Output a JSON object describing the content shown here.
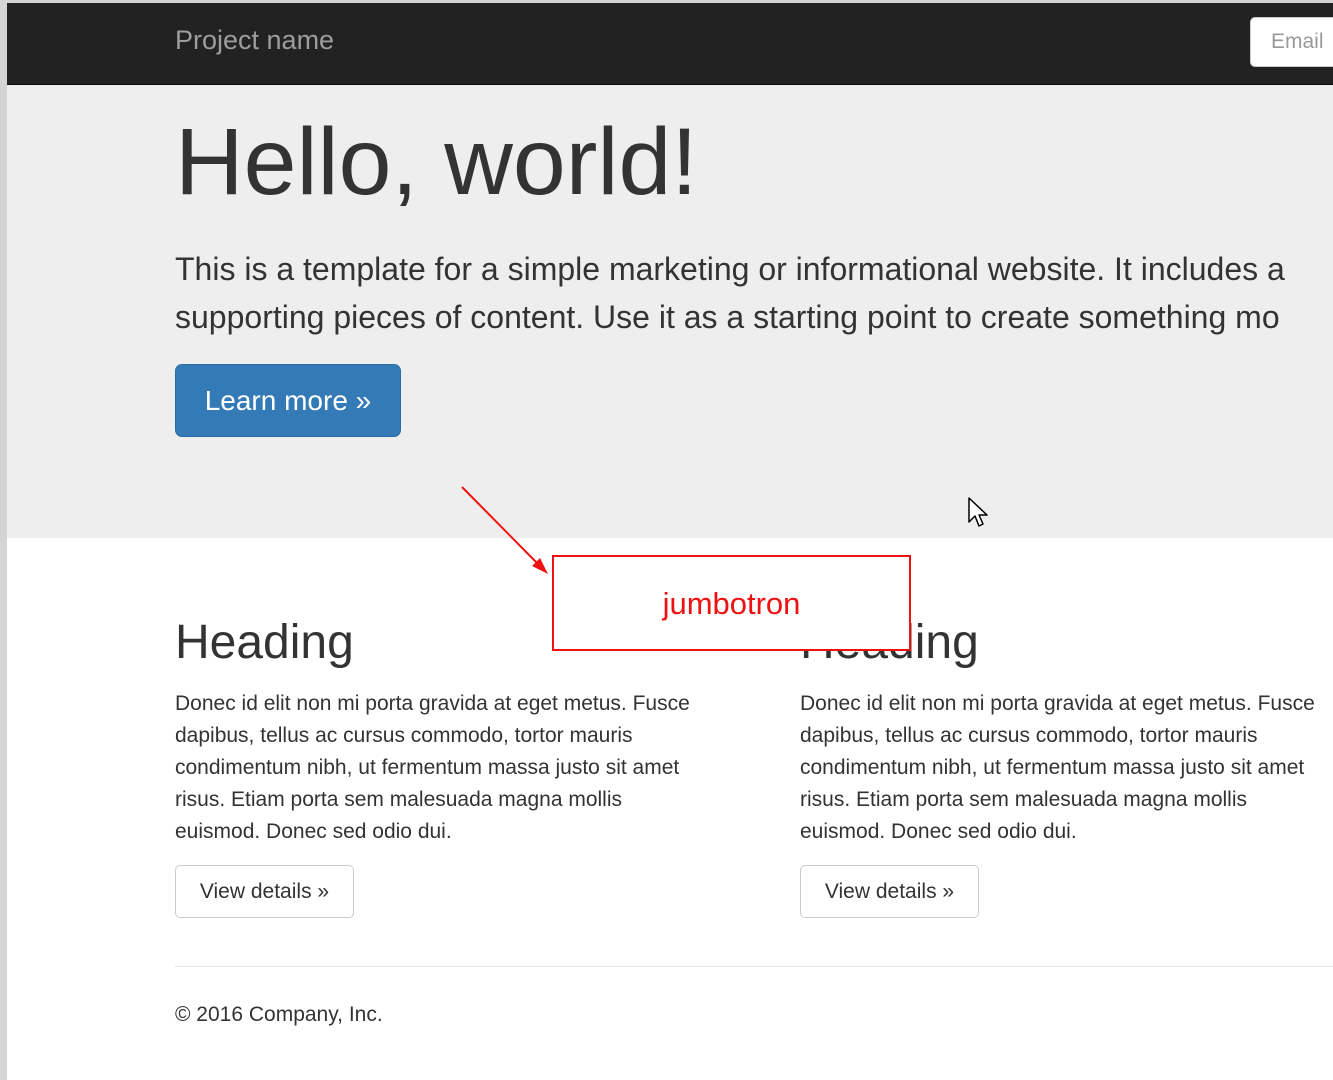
{
  "navbar": {
    "brand": "Project name",
    "email_placeholder": "Email"
  },
  "jumbotron": {
    "title": "Hello, world!",
    "lead_lines": [
      "This is a template for a simple marketing or informational website. It includes a",
      "supporting pieces of content. Use it as a starting point to create something mo"
    ],
    "button_label": "Learn more »"
  },
  "columns": [
    {
      "heading": "Heading",
      "body_lines": [
        "Donec id elit non mi porta gravida at eget metus. Fusce",
        "dapibus, tellus ac cursus commodo, tortor mauris",
        "condimentum nibh, ut fermentum massa justo sit amet",
        "risus. Etiam porta sem malesuada magna mollis",
        "euismod. Donec sed odio dui."
      ],
      "button_label": "View details »"
    },
    {
      "heading": "Heading",
      "body_lines": [
        "Donec id elit non mi porta gravida at eget metus. Fusce",
        "dapibus, tellus ac cursus commodo, tortor mauris",
        "condimentum nibh, ut fermentum massa justo sit amet",
        "risus. Etiam porta sem malesuada magna mollis",
        "euismod. Donec sed odio dui."
      ],
      "button_label": "View details »"
    }
  ],
  "footer": {
    "copyright": "© 2016 Company, Inc."
  },
  "annotation": {
    "label": "jumbotron",
    "color": "#ee1111"
  },
  "colors": {
    "navbar_bg": "#222222",
    "jumbotron_bg": "#eeeeee",
    "primary": "#337ab7"
  },
  "icons": {
    "cursor": "mouse-pointer-icon",
    "arrow": "annotation-arrow-icon"
  }
}
